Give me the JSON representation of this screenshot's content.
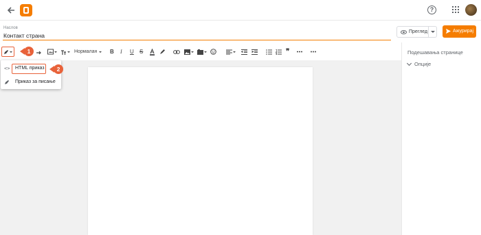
{
  "topbar": {
    "back_icon": "arrow-left-icon",
    "logo_icon": "blogger-logo-icon",
    "help_icon": "help-circle-icon",
    "apps_icon": "apps-grid-icon",
    "avatar_icon": "user-avatar"
  },
  "editor": {
    "title_placeholder": "Наслов",
    "title_value": "Контакт страна",
    "preview_label": "Преглед",
    "update_label": "Ажурирај",
    "accent_color": "#f57d00"
  },
  "toolbar": {
    "paragraph_style": "Нормалан"
  },
  "mode_menu": {
    "items": [
      {
        "icon": "code-icon",
        "label": "HTML приказ"
      },
      {
        "icon": "pencil-icon",
        "label": "Приказ за писање"
      }
    ]
  },
  "right_panel": {
    "title": "Подешавања странице",
    "options_label": "Опције"
  },
  "callouts": {
    "first": "1",
    "second": "2",
    "color": "#e8623a"
  }
}
